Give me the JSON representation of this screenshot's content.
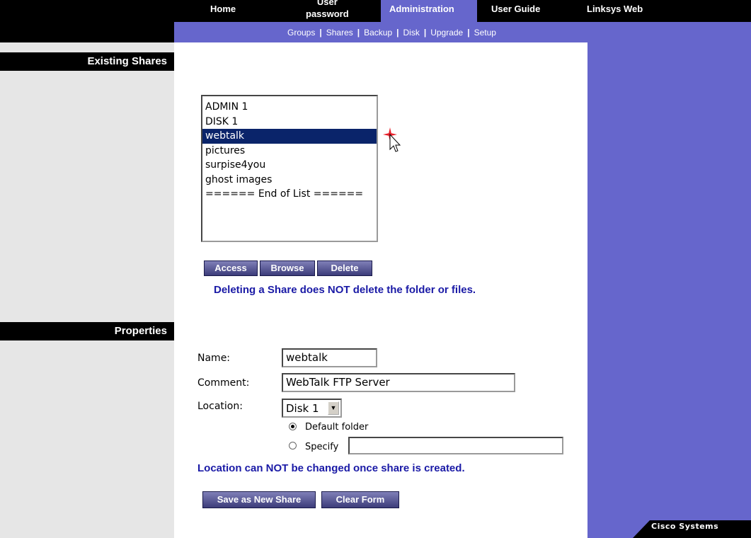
{
  "top_nav": {
    "home": "Home",
    "password_line1": "User",
    "password_line2": "password",
    "administration": "Administration",
    "user_guide": "User Guide",
    "linksys_web": "Linksys Web"
  },
  "sub_nav": {
    "items": [
      "Groups",
      "Shares",
      "Backup",
      "Disk",
      "Upgrade",
      "Setup"
    ],
    "separator": "|"
  },
  "existing_shares": {
    "header": "Existing Shares",
    "list": [
      "ADMIN 1",
      "DISK 1",
      "webtalk",
      "pictures",
      "surpise4you",
      "ghost images",
      "====== End of List ======"
    ],
    "selected_index": 2,
    "buttons": {
      "access": "Access",
      "browse": "Browse",
      "delete": "Delete"
    },
    "notice": "Deleting a Share does NOT delete the folder or files."
  },
  "properties": {
    "header": "Properties",
    "name_label": "Name:",
    "name_value": "webtalk",
    "comment_label": "Comment:",
    "comment_value": "WebTalk FTP Server",
    "location_label": "Location:",
    "location_value": "Disk 1",
    "default_folder_label": "Default folder",
    "specify_label": "Specify",
    "specify_value": "",
    "location_selected": "default",
    "notice": "Location can NOT be changed once share is created.",
    "buttons": {
      "save": "Save as New Share",
      "clear": "Clear Form"
    }
  },
  "brand": {
    "logo_text": "Cisco Systems"
  },
  "colors": {
    "accent": "#6666cc",
    "notice": "#1a1aa6",
    "selection": "#0a246a"
  },
  "icons": {
    "cursor": "mouse-pointer-icon",
    "select_arrow": "chevron-down-icon"
  }
}
